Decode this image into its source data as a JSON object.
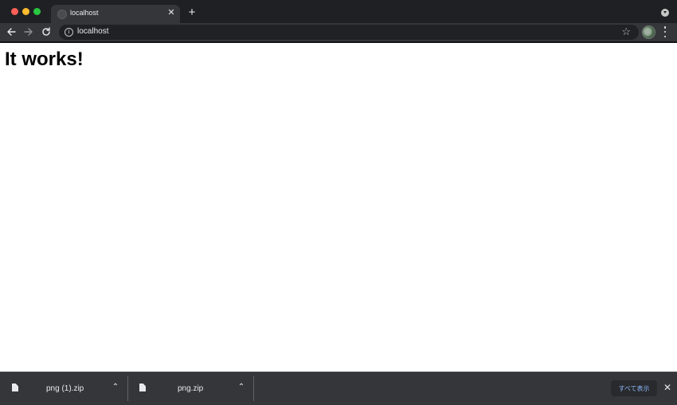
{
  "window": {
    "controls": [
      "close",
      "minimize",
      "maximize"
    ],
    "colors": {
      "close": "#fe5f57",
      "minimize": "#febc2e",
      "maximize": "#28c840"
    }
  },
  "tabs": [
    {
      "title": "localhost",
      "favicon": "globe-icon",
      "active": true,
      "close_glyph": "✕"
    }
  ],
  "new_tab_glyph": "+",
  "toolbar": {
    "back_icon": "arrow-left-icon",
    "forward_icon": "arrow-right-icon",
    "reload_icon": "reload-icon",
    "address": {
      "site_info_icon": "info-icon",
      "site_info_glyph": "i",
      "url": "localhost",
      "bookmark_glyph": "☆"
    },
    "profile_icon": "avatar",
    "menu_icon": "more-vert-icon"
  },
  "page": {
    "heading": "It works!"
  },
  "downloads": {
    "items": [
      {
        "name": "png (1).zip",
        "icon": "file-icon",
        "chevron": "⌃"
      },
      {
        "name": "png.zip",
        "icon": "file-icon",
        "chevron": "⌃"
      }
    ],
    "show_all_label": "すべて表示",
    "close_glyph": "✕"
  },
  "theme": {
    "titlebar_bg": "#1f2023",
    "toolbar_bg": "#35363a",
    "omnibox_bg": "#202124",
    "text": "#e8eaed",
    "link": "#8ab4f8"
  }
}
